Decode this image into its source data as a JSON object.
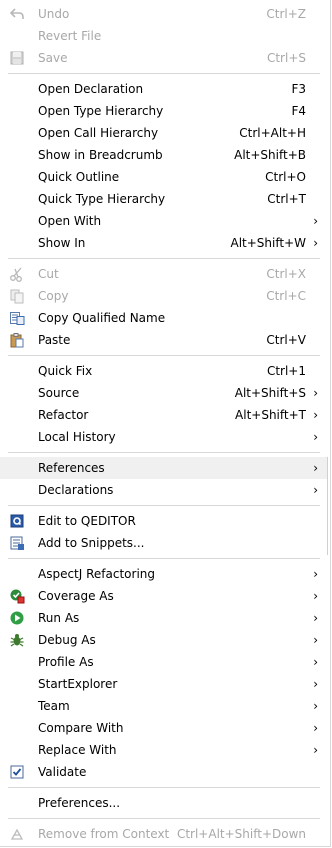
{
  "menu": {
    "undo": {
      "label": "Undo",
      "shortcut": "Ctrl+Z"
    },
    "revert": {
      "label": "Revert File"
    },
    "save": {
      "label": "Save",
      "shortcut": "Ctrl+S"
    },
    "open_decl": {
      "label": "Open Declaration",
      "shortcut": "F3"
    },
    "open_type_h": {
      "label": "Open Type Hierarchy",
      "shortcut": "F4"
    },
    "open_call_h": {
      "label": "Open Call Hierarchy",
      "shortcut": "Ctrl+Alt+H"
    },
    "breadcrumb": {
      "label": "Show in Breadcrumb",
      "shortcut": "Alt+Shift+B"
    },
    "quick_outline": {
      "label": "Quick Outline",
      "shortcut": "Ctrl+O"
    },
    "quick_type_h": {
      "label": "Quick Type Hierarchy",
      "shortcut": "Ctrl+T"
    },
    "open_with": {
      "label": "Open With"
    },
    "show_in": {
      "label": "Show In",
      "shortcut": "Alt+Shift+W"
    },
    "cut": {
      "label": "Cut",
      "shortcut": "Ctrl+X"
    },
    "copy": {
      "label": "Copy",
      "shortcut": "Ctrl+C"
    },
    "copy_qn": {
      "label": "Copy Qualified Name"
    },
    "paste": {
      "label": "Paste",
      "shortcut": "Ctrl+V"
    },
    "quick_fix": {
      "label": "Quick Fix",
      "shortcut": "Ctrl+1"
    },
    "source": {
      "label": "Source",
      "shortcut": "Alt+Shift+S"
    },
    "refactor": {
      "label": "Refactor",
      "shortcut": "Alt+Shift+T"
    },
    "local_history": {
      "label": "Local History"
    },
    "references": {
      "label": "References"
    },
    "declarations": {
      "label": "Declarations"
    },
    "qeditor": {
      "label": "Edit to QEDITOR"
    },
    "snippets": {
      "label": "Add to Snippets..."
    },
    "aspectj": {
      "label": "AspectJ Refactoring"
    },
    "coverage": {
      "label": "Coverage As"
    },
    "run_as": {
      "label": "Run As"
    },
    "debug_as": {
      "label": "Debug As"
    },
    "profile_as": {
      "label": "Profile As"
    },
    "startexplorer": {
      "label": "StartExplorer"
    },
    "team": {
      "label": "Team"
    },
    "compare_with": {
      "label": "Compare With"
    },
    "replace_with": {
      "label": "Replace With"
    },
    "validate": {
      "label": "Validate"
    },
    "preferences": {
      "label": "Preferences..."
    },
    "remove_ctx": {
      "label": "Remove from Context",
      "shortcut": "Ctrl+Alt+Shift+Down"
    },
    "submenu_arrow": "›"
  },
  "colors": {
    "hover_bg": "#f0f0f0",
    "separator": "#d8d8d8",
    "disabled_text": "#a8a8a8"
  }
}
